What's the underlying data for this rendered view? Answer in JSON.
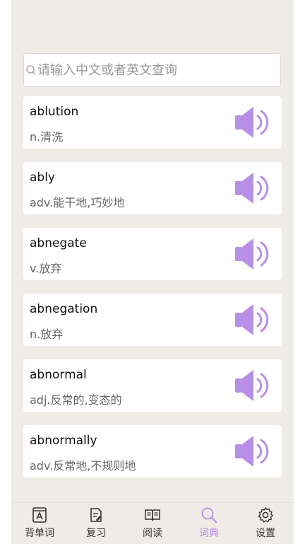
{
  "search": {
    "placeholder": "请输入中文或者英文查询",
    "value": ""
  },
  "words": [
    {
      "word": "ablution",
      "meaning": "n.清洗"
    },
    {
      "word": "ably",
      "meaning": "adv.能干地,巧妙地"
    },
    {
      "word": "abnegate",
      "meaning": "v.放弃"
    },
    {
      "word": "abnegation",
      "meaning": "n.放弃"
    },
    {
      "word": "abnormal",
      "meaning": "adj.反常的,变态的"
    },
    {
      "word": "abnormally",
      "meaning": "adv.反常地,不规则地"
    }
  ],
  "tabs": [
    {
      "label": "背单词",
      "icon": "flashcard-icon"
    },
    {
      "label": "复习",
      "icon": "review-icon"
    },
    {
      "label": "阅读",
      "icon": "book-icon"
    },
    {
      "label": "词典",
      "icon": "search-icon",
      "active": true
    },
    {
      "label": "设置",
      "icon": "gear-icon"
    }
  ],
  "colors": {
    "accent": "#b98ee6",
    "background": "#efebe7",
    "card": "#ffffff"
  }
}
